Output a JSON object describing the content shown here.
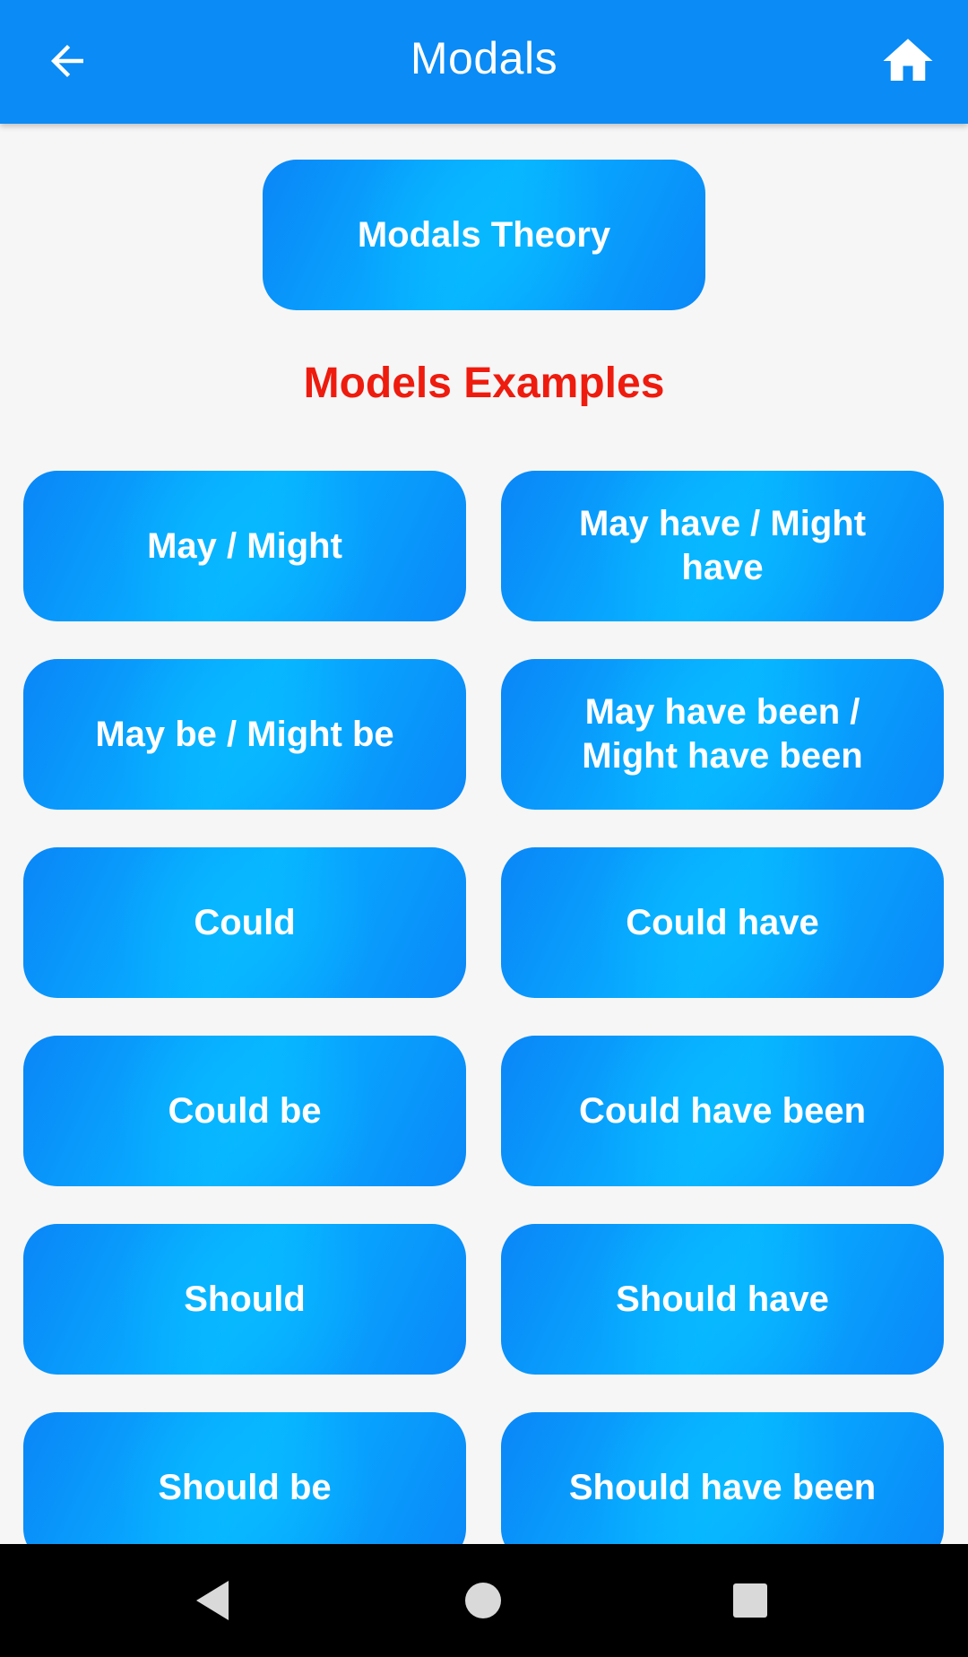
{
  "app_bar": {
    "title": "Modals",
    "back_icon": "arrow-left-icon",
    "home_icon": "home-icon"
  },
  "theory_button": {
    "label": "Modals Theory"
  },
  "section_title": "Models Examples",
  "examples": [
    {
      "label": "May / Might"
    },
    {
      "label": "May have / Might have"
    },
    {
      "label": "May be / Might be"
    },
    {
      "label": "May have been / Might have been"
    },
    {
      "label": "Could"
    },
    {
      "label": "Could have"
    },
    {
      "label": "Could be"
    },
    {
      "label": "Could have been"
    },
    {
      "label": "Should"
    },
    {
      "label": "Should have"
    },
    {
      "label": "Should be"
    },
    {
      "label": "Should have been"
    }
  ],
  "colors": {
    "app_bar": "#0a8bf5",
    "button_gradient_edge": "#0a86f7",
    "button_gradient_center": "#06b6ff",
    "section_title": "#ee1c0e",
    "background": "#f6f6f7"
  },
  "system_nav": {
    "back_icon": "triangle-back-icon",
    "home_icon": "circle-home-icon",
    "recents_icon": "square-recents-icon"
  }
}
